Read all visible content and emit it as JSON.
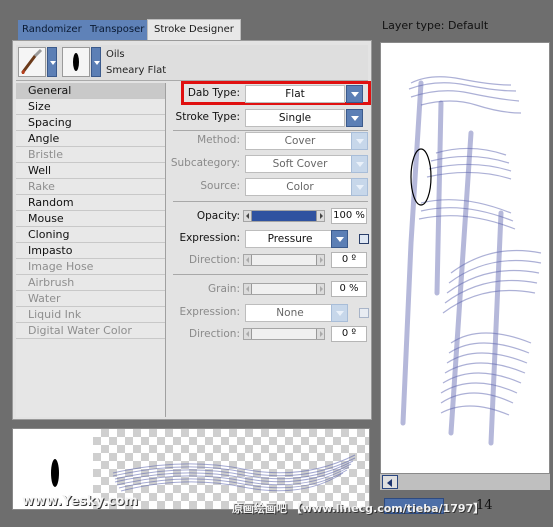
{
  "tabs": [
    {
      "label": "Randomizer"
    },
    {
      "label": "Transposer"
    },
    {
      "label": "Stroke Designer"
    }
  ],
  "brush": {
    "category": "Oils",
    "variant": "Smeary Flat",
    "category_icon": "paintbrush-icon",
    "variant_icon": "dab-shape-icon"
  },
  "categories": [
    {
      "label": "General",
      "selected": true,
      "enabled": true
    },
    {
      "label": "Size",
      "enabled": true
    },
    {
      "label": "Spacing",
      "enabled": true
    },
    {
      "label": "Angle",
      "enabled": true
    },
    {
      "label": "Bristle",
      "enabled": false
    },
    {
      "label": "Well",
      "enabled": true
    },
    {
      "label": "Rake",
      "enabled": false
    },
    {
      "label": "Random",
      "enabled": true
    },
    {
      "label": "Mouse",
      "enabled": true
    },
    {
      "label": "Cloning",
      "enabled": true
    },
    {
      "label": "Impasto",
      "enabled": true
    },
    {
      "label": "Image Hose",
      "enabled": false
    },
    {
      "label": "Airbrush",
      "enabled": false
    },
    {
      "label": "Water",
      "enabled": false
    },
    {
      "label": "Liquid Ink",
      "enabled": false
    },
    {
      "label": "Digital Water Color",
      "enabled": false
    }
  ],
  "form": {
    "dab_type": {
      "label": "Dab Type:",
      "value": "Flat"
    },
    "stroke_type": {
      "label": "Stroke Type:",
      "value": "Single"
    },
    "method": {
      "label": "Method:",
      "value": "Cover"
    },
    "subcategory": {
      "label": "Subcategory:",
      "value": "Soft Cover"
    },
    "source": {
      "label": "Source:",
      "value": "Color"
    },
    "opacity": {
      "label": "Opacity:",
      "value": "100 %",
      "fraction": 1.0
    },
    "expression1": {
      "label": "Expression:",
      "value": "Pressure"
    },
    "direction1": {
      "label": "Direction:",
      "value": "0 º"
    },
    "grain": {
      "label": "Grain:",
      "value": "0 %"
    },
    "expression2": {
      "label": "Expression:",
      "value": "None"
    },
    "direction2": {
      "label": "Direction:",
      "value": "0 º"
    }
  },
  "layer": {
    "label": "Layer type: Default"
  },
  "status": {
    "page": "14"
  },
  "watermarks": {
    "left": "www.Yesky.com",
    "right": "原画绘画吧 【www.linecg.com/tieba/1797】"
  },
  "colors": {
    "accent": "#5c7fb5",
    "stroke": "#5a62ad",
    "highlight": "#e01010"
  }
}
